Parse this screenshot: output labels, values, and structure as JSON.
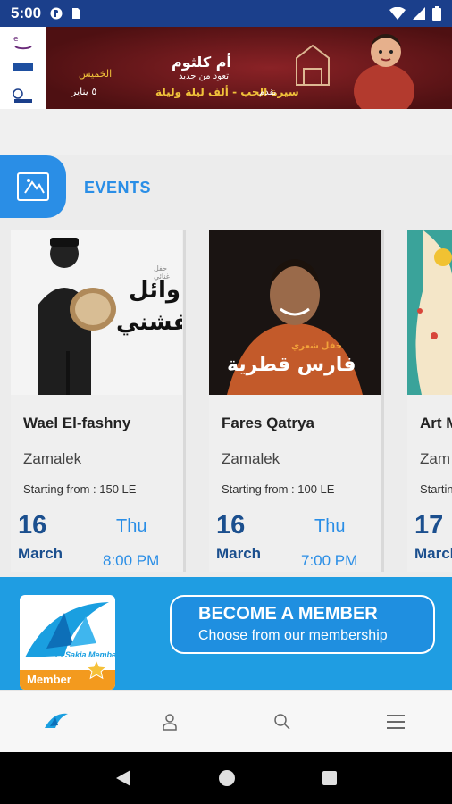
{
  "status_bar": {
    "time": "5:00"
  },
  "banner": {
    "title_ar": "أم كلثوم",
    "subtitle_ar": "تعود من جديد",
    "show_ar": "سيرة الحب - ألف ليلة وليلة",
    "presents_ar": "يقدم",
    "day_ar": "الخميس",
    "date_ar": "٥ يناير"
  },
  "events": {
    "title": "EVENTS",
    "cards": [
      {
        "name": "Wael El-fashny",
        "venue": "Zamalek",
        "price": "Starting from : 150 LE",
        "day": "16",
        "month": "March",
        "weekday": "Thu",
        "time": "8:00 PM",
        "poster_ar_1": "وائل",
        "poster_ar_2": "الفشني",
        "poster_small_ar": "حفل غنائي"
      },
      {
        "name": "Fares Qatrya",
        "venue": "Zamalek",
        "price": "Starting from : 100 LE",
        "day": "16",
        "month": "March",
        "weekday": "Thu",
        "time": "7:00 PM",
        "poster_ar_1": "فارس قطرية",
        "poster_small_ar": "حفل شعري"
      },
      {
        "name": "Art M",
        "venue": "Zam",
        "price": "Startin",
        "day": "17",
        "month": "March"
      }
    ]
  },
  "membership": {
    "card_label": "El Sakia Membership",
    "ribbon": "Member",
    "button_title": "BECOME A MEMBER",
    "button_sub": "Choose from our membership"
  },
  "bottom_nav": [
    "home-icon",
    "profile-icon",
    "search-icon",
    "menu-icon"
  ],
  "colors": {
    "status_bar": "#1b3f8b",
    "accent": "#2a8ee6",
    "date_blue": "#1b4f8e",
    "member_bg": "#1f9de2",
    "ribbon": "#f39a1e"
  }
}
